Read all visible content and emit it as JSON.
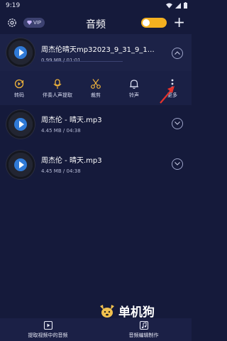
{
  "status": {
    "time": "9:19"
  },
  "header": {
    "vip_label": "VIP",
    "title": "音频"
  },
  "files": [
    {
      "name": "周杰伦晴天mp32023_9_31_9_14_6…",
      "size": "0.99 MB",
      "duration": "01:01",
      "expanded": true,
      "progress": 0
    },
    {
      "name": "周杰伦 - 晴天.mp3",
      "size": "4.45 MB",
      "duration": "04:38",
      "expanded": false
    },
    {
      "name": "周杰伦 - 晴天.mp3",
      "size": "4.45 MB",
      "duration": "04:38",
      "expanded": false
    }
  ],
  "toolbar": {
    "items": [
      {
        "label": "转码",
        "icon": "convert-icon"
      },
      {
        "label": "伴奏人声提取",
        "icon": "vocal-extract-icon"
      },
      {
        "label": "裁剪",
        "icon": "scissors-icon"
      },
      {
        "label": "铃声",
        "icon": "bell-icon"
      },
      {
        "label": "更多",
        "icon": "more-vertical-icon"
      }
    ]
  },
  "bottom_nav": [
    {
      "label": "提取视频中的音频",
      "icon": "video-extract-icon"
    },
    {
      "label": "音频编辑制作",
      "icon": "audio-edit-icon"
    }
  ],
  "watermark": {
    "text": "单机狗"
  },
  "colors": {
    "accent": "#3d8bff",
    "toggle": "#f3b020",
    "toolbar_icon": "#f0b43c",
    "annotation_arrow": "#e5322d",
    "background": "#151a3b"
  }
}
